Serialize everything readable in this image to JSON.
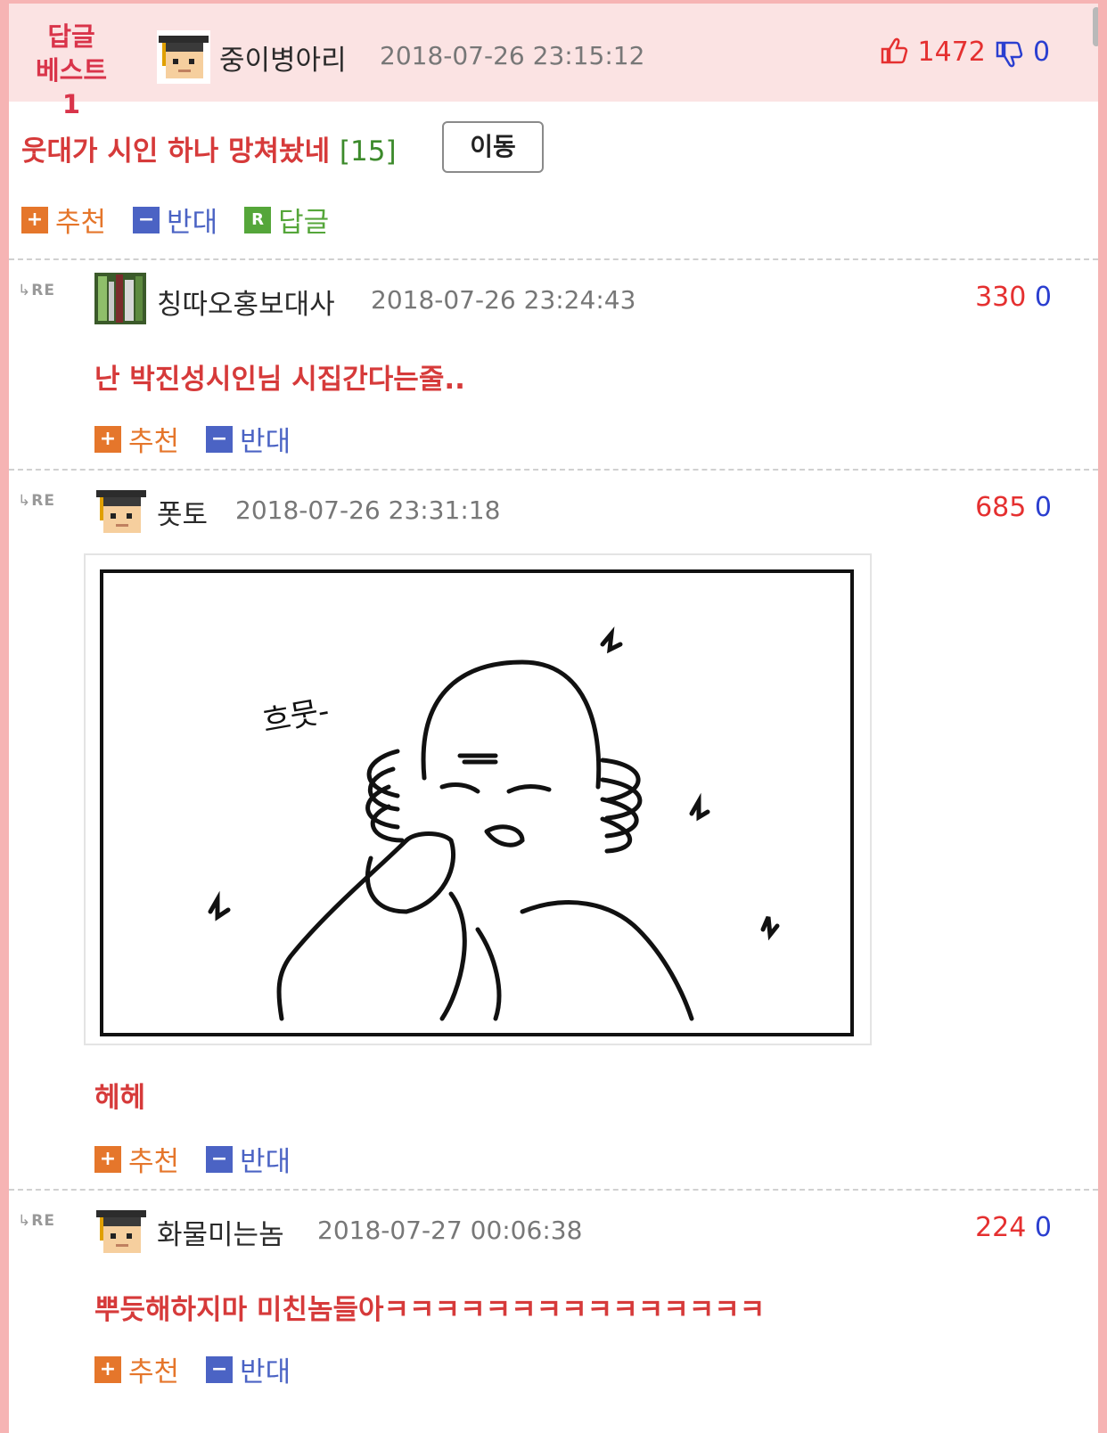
{
  "best": {
    "badge_line1": "답글",
    "badge_line2": "베스트1",
    "nickname": "중이병아리",
    "datetime": "2018-07-26 23:15:12",
    "upvotes": "1472",
    "downvotes": "0",
    "title": "웃대가 시인 하나 망쳐놨네",
    "comment_count": "[15]",
    "move_label": "이동",
    "recommend_label": "추천",
    "oppose_label": "반대",
    "reply_label": "답글"
  },
  "re_label": "RE",
  "comments": [
    {
      "nickname": "칭따오홍보대사",
      "datetime": "2018-07-26 23:24:43",
      "upvotes": "330",
      "downvotes": "0",
      "text": "난 박진성시인님 시집간다는줄..",
      "recommend_label": "추천",
      "oppose_label": "반대"
    },
    {
      "nickname": "폿토",
      "datetime": "2018-07-26 23:31:18",
      "upvotes": "685",
      "downvotes": "0",
      "image_caption": "흐뭇-",
      "text": "헤헤",
      "recommend_label": "추천",
      "oppose_label": "반대"
    },
    {
      "nickname": "화물미는놈",
      "datetime": "2018-07-27 00:06:38",
      "upvotes": "224",
      "downvotes": "0",
      "text": "뿌듯해하지마 미친놈들아ㅋㅋㅋㅋㅋㅋㅋㅋㅋㅋㅋㅋㅋㅋㅋ",
      "recommend_label": "추천",
      "oppose_label": "반대"
    }
  ],
  "colors": {
    "accent_red": "#d63a3a",
    "up_red": "#e53030",
    "down_blue": "#2b3fd0",
    "recommend_orange": "#e5762b",
    "oppose_blue": "#4b63c4",
    "reply_green": "#55a63a"
  },
  "icons": [
    "graduate-avatar",
    "user-photo-avatar",
    "thumbs-up-icon",
    "thumbs-down-icon",
    "reply-arrow-icon"
  ]
}
